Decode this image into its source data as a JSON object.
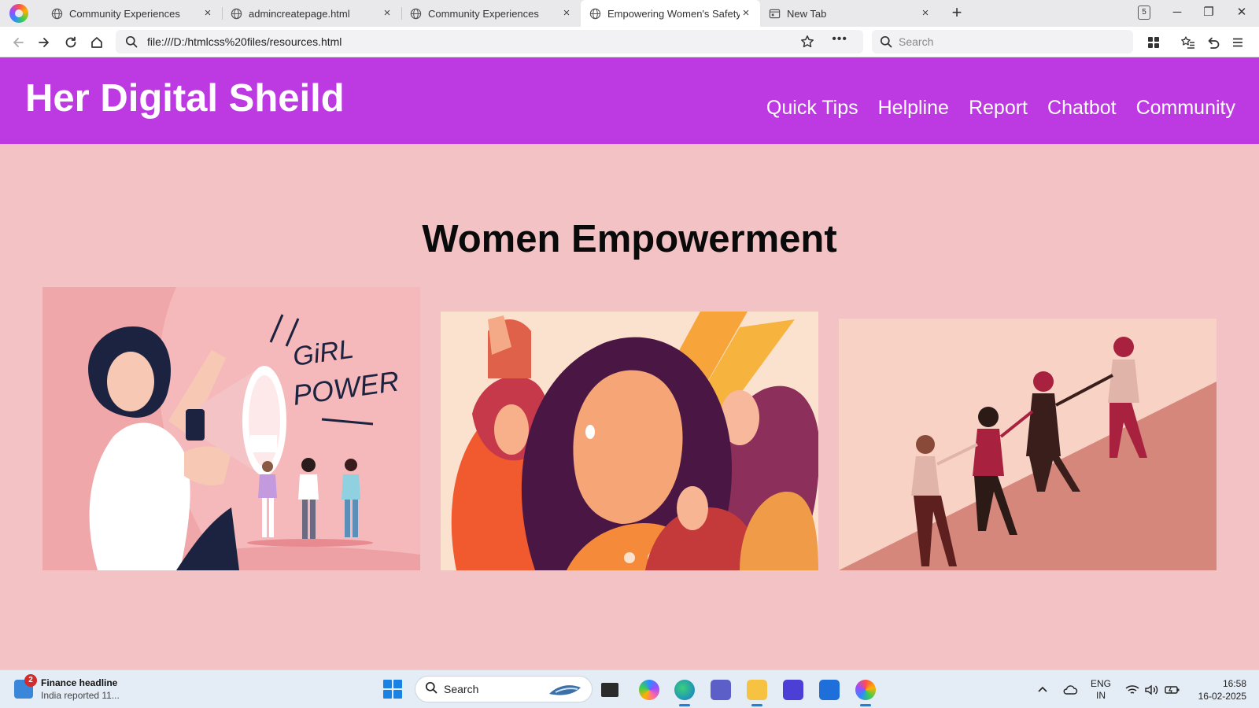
{
  "browser": {
    "tabs": [
      {
        "title": "Community Experiences"
      },
      {
        "title": "admincreatepage.html"
      },
      {
        "title": "Community Experiences"
      },
      {
        "title": "Empowering Women's Safety"
      },
      {
        "title": "New Tab"
      }
    ],
    "active_tab_index": 3,
    "tab_count": "5",
    "address": "file:///D:/htmlcss%20files/resources.html",
    "search_placeholder": "Search"
  },
  "site": {
    "brand": "Her Digital Sheild",
    "nav": [
      "Quick Tips",
      "Helpline",
      "Report",
      "Chatbot",
      "Community"
    ],
    "heading": "Women Empowerment",
    "gallery": [
      {
        "subject": "woman-with-megaphone",
        "caption_art": "GIRL POWER"
      },
      {
        "subject": "group-of-women-portrait"
      },
      {
        "subject": "women-climbing-together"
      }
    ],
    "colors": {
      "header": "#bd39e1",
      "background": "#f3c2c4"
    }
  },
  "taskbar": {
    "widget_badge": "2",
    "widget_title": "Finance headline",
    "widget_subtitle": "India reported 11...",
    "search_label": "Search",
    "language": "ENG",
    "region": "IN",
    "time": "16:58",
    "date": "16-02-2025"
  }
}
